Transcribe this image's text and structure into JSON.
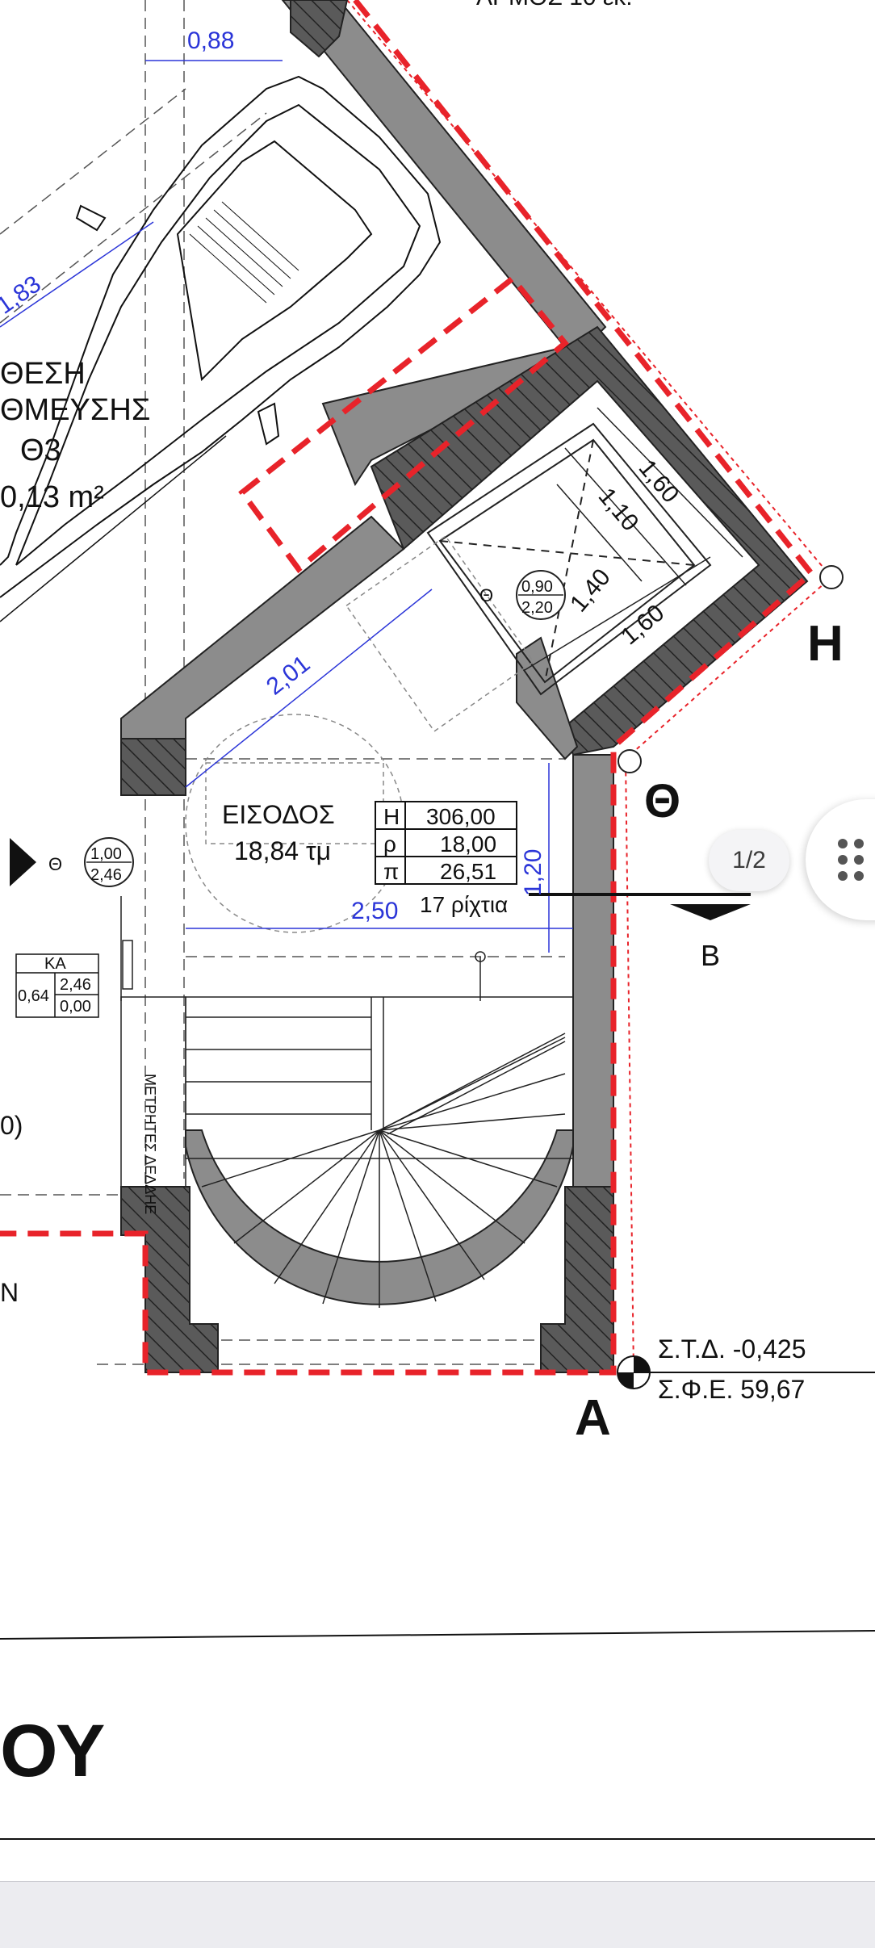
{
  "viewer": {
    "page_indicator": "1/2"
  },
  "plan": {
    "dim_top": "0,88",
    "dim_car": "1,83",
    "parking_label_1": "ΘΕΣΗ",
    "parking_label_2": "ΘΜΕΥΣΗΣ",
    "parking_label_3": "Θ3",
    "parking_area": "0,13 m²",
    "top_cut_text": "ΑΡΜΟΣ 10 εκ.",
    "elev_dim_1": "1,60",
    "elev_dim_2": "1,10",
    "elev_dim_3": "1,40",
    "elev_dim_4": "1,60",
    "door_symbol": "Θ",
    "elev_door_top": "0,90",
    "elev_door_bottom": "2,20",
    "dim_diag": "2,01",
    "entrance_label": "ΕΙΣΟΔΟΣ",
    "entrance_area": "18,84 τμ",
    "stair_table": [
      {
        "key": "Η",
        "value": "306,00"
      },
      {
        "key": "ρ",
        "value": "18,00"
      },
      {
        "key": "π",
        "value": "26,51"
      }
    ],
    "dim_vertical": "1,20",
    "dim_width": "2,50",
    "risers": "17 ρίχτια",
    "door_left_symbol": "Θ",
    "door_left_top": "1,00",
    "door_left_bottom": "2,46",
    "ka_header": "ΚΑ",
    "ka_left": "0,64",
    "ka_top": "2,46",
    "ka_bottom": "0,00",
    "meters_label": "ΜΕΤΡΗΤΕΣ ΔΕΔΔΗΕ",
    "left_cut_paren": "0)",
    "left_cut_n": "N",
    "corner_h": "Η",
    "corner_theta": "Θ",
    "corner_a": "Α",
    "section_b": "Β",
    "elev_std": "Σ.Τ.Δ. -0,425",
    "elev_sfe": "Σ.Φ.Ε.  59,67",
    "title_fragment": "ΟΥ"
  },
  "colors": {
    "wall_gray": "#8c8c8c",
    "wall_dark": "#555555",
    "wall_light": "#cfcfcf",
    "boundary_red": "#e8232a",
    "dimension_blue": "#2b35d8"
  }
}
